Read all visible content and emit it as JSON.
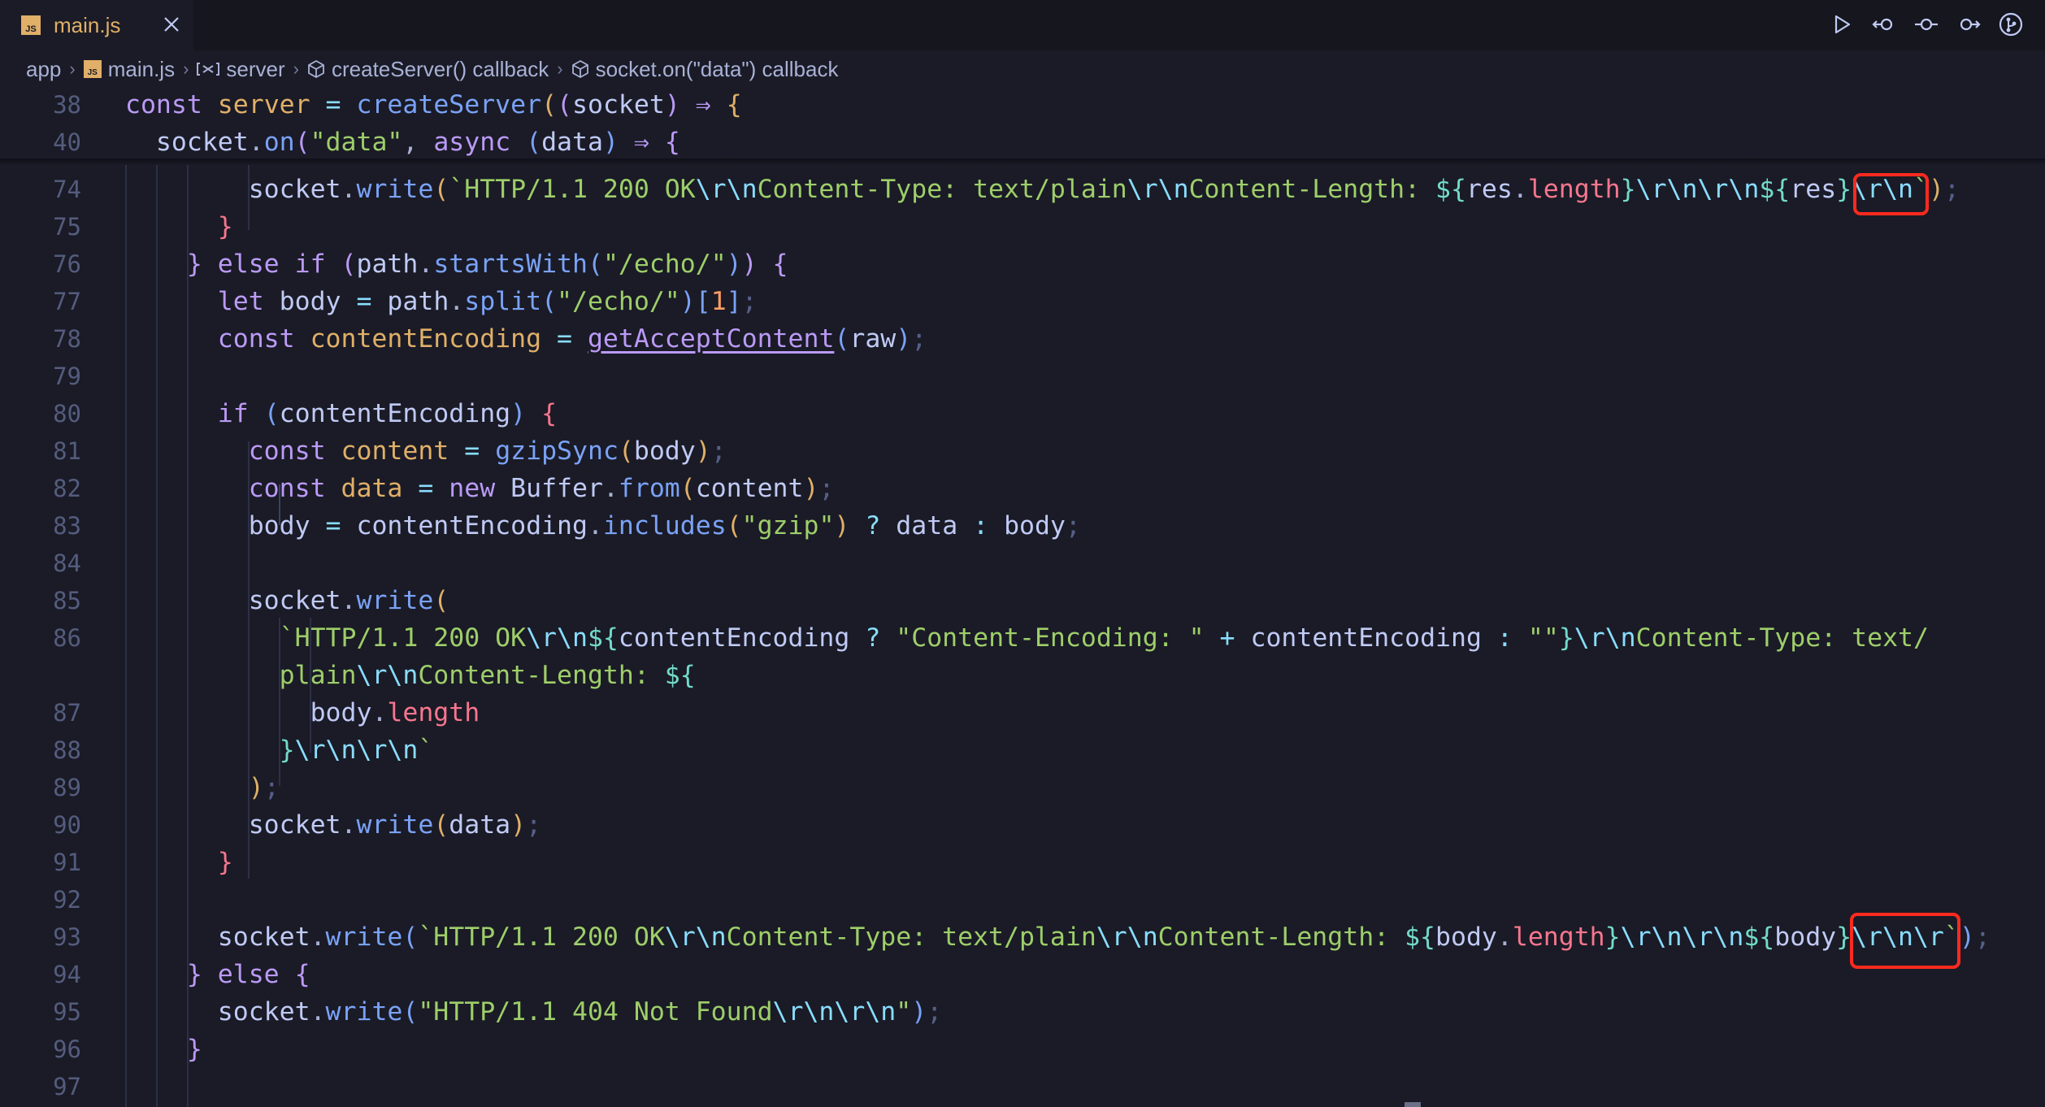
{
  "tab": {
    "label": "main.js",
    "badge": "JS"
  },
  "breadcrumb": {
    "items": [
      "app",
      "main.js",
      "server",
      "createServer() callback",
      "socket.on(\"data\") callback"
    ]
  },
  "editor": {
    "lines": [
      {
        "n": "38",
        "tokens": [
          [
            "k",
            "const "
          ],
          [
            "pl",
            "server"
          ],
          [
            "o",
            " = "
          ],
          [
            "f",
            "createServer"
          ],
          [
            "b1",
            "("
          ],
          [
            "b2",
            "("
          ],
          [
            "v",
            "socket"
          ],
          [
            "b2",
            ")"
          ],
          [
            "k",
            " ⇒ "
          ],
          [
            "b1",
            "{"
          ]
        ]
      },
      {
        "n": "40",
        "tokens": [
          [
            "v",
            "  socket"
          ],
          [
            "p",
            "."
          ],
          [
            "f",
            "on"
          ],
          [
            "b2",
            "("
          ],
          [
            "s",
            "\"data\""
          ],
          [
            "p",
            ", "
          ],
          [
            "k",
            "async "
          ],
          [
            "b3",
            "("
          ],
          [
            "v",
            "data"
          ],
          [
            "b3",
            ")"
          ],
          [
            "k",
            " ⇒ "
          ],
          [
            "b2",
            "{"
          ]
        ]
      },
      {
        "n": "74",
        "tokens": [
          [
            "v",
            "        socket"
          ],
          [
            "p",
            "."
          ],
          [
            "f",
            "write"
          ],
          [
            "b1",
            "("
          ],
          [
            "s",
            "`HTTP/1.1 200 OK"
          ],
          [
            "o",
            "\\r\\n"
          ],
          [
            "s",
            "Content-Type: text/plain"
          ],
          [
            "o",
            "\\r\\n"
          ],
          [
            "s",
            "Content-Length: "
          ],
          [
            "c2",
            "${"
          ],
          [
            "v",
            "res"
          ],
          [
            "p",
            "."
          ],
          [
            "pp",
            "length"
          ],
          [
            "c2",
            "}"
          ],
          [
            "o",
            "\\r\\n\\r\\n"
          ],
          [
            "c2",
            "${"
          ],
          [
            "v",
            "res"
          ],
          [
            "c2",
            "}"
          ],
          [
            "o",
            "\\r\\n"
          ],
          [
            "s",
            "`"
          ],
          [
            "b1",
            ")"
          ],
          [
            "dim",
            ";"
          ]
        ]
      },
      {
        "n": "75",
        "tokens": [
          [
            "pp",
            "      }"
          ]
        ]
      },
      {
        "n": "76",
        "tokens": [
          [
            "b2",
            "    }"
          ],
          [
            "k",
            " else if "
          ],
          [
            "b2",
            "("
          ],
          [
            "v",
            "path"
          ],
          [
            "p",
            "."
          ],
          [
            "f",
            "startsWith"
          ],
          [
            "b3",
            "("
          ],
          [
            "s",
            "\"/echo/\""
          ],
          [
            "b3",
            ")"
          ],
          [
            "b2",
            ")"
          ],
          [
            "b2",
            " {"
          ]
        ]
      },
      {
        "n": "77",
        "tokens": [
          [
            "k",
            "      let "
          ],
          [
            "v",
            "body"
          ],
          [
            "o",
            " = "
          ],
          [
            "v",
            "path"
          ],
          [
            "p",
            "."
          ],
          [
            "f",
            "split"
          ],
          [
            "b3",
            "("
          ],
          [
            "s",
            "\"/echo/\""
          ],
          [
            "b3",
            ")"
          ],
          [
            "b3",
            "["
          ],
          [
            "n",
            "1"
          ],
          [
            "b3",
            "]"
          ],
          [
            "dim",
            ";"
          ]
        ]
      },
      {
        "n": "78",
        "tokens": [
          [
            "k",
            "      const "
          ],
          [
            "pl",
            "contentEncoding"
          ],
          [
            "o",
            " = "
          ],
          [
            "u",
            "getAcceptContent"
          ],
          [
            "b3",
            "("
          ],
          [
            "v",
            "raw"
          ],
          [
            "b3",
            ")"
          ],
          [
            "dim",
            ";"
          ]
        ]
      },
      {
        "n": "79",
        "tokens": []
      },
      {
        "n": "80",
        "tokens": [
          [
            "k",
            "      if "
          ],
          [
            "b3",
            "("
          ],
          [
            "v",
            "contentEncoding"
          ],
          [
            "b3",
            ")"
          ],
          [
            "pp",
            " {"
          ]
        ]
      },
      {
        "n": "81",
        "tokens": [
          [
            "k",
            "        const "
          ],
          [
            "pl",
            "content"
          ],
          [
            "o",
            " = "
          ],
          [
            "f",
            "gzipSync"
          ],
          [
            "b1",
            "("
          ],
          [
            "v",
            "body"
          ],
          [
            "b1",
            ")"
          ],
          [
            "dim",
            ";"
          ]
        ]
      },
      {
        "n": "82",
        "tokens": [
          [
            "k",
            "        const "
          ],
          [
            "pl",
            "data"
          ],
          [
            "o",
            " = "
          ],
          [
            "k",
            "new "
          ],
          [
            "v",
            "Buffer"
          ],
          [
            "p",
            "."
          ],
          [
            "f",
            "from"
          ],
          [
            "b1",
            "("
          ],
          [
            "v",
            "content"
          ],
          [
            "b1",
            ")"
          ],
          [
            "dim",
            ";"
          ]
        ]
      },
      {
        "n": "83",
        "tokens": [
          [
            "v",
            "        body"
          ],
          [
            "o",
            " = "
          ],
          [
            "v",
            "contentEncoding"
          ],
          [
            "p",
            "."
          ],
          [
            "f",
            "includes"
          ],
          [
            "b1",
            "("
          ],
          [
            "s",
            "\"gzip\""
          ],
          [
            "b1",
            ")"
          ],
          [
            "o",
            " ? "
          ],
          [
            "v",
            "data"
          ],
          [
            "o",
            " : "
          ],
          [
            "v",
            "body"
          ],
          [
            "dim",
            ";"
          ]
        ]
      },
      {
        "n": "84",
        "tokens": []
      },
      {
        "n": "85",
        "tokens": [
          [
            "v",
            "        socket"
          ],
          [
            "p",
            "."
          ],
          [
            "f",
            "write"
          ],
          [
            "b1",
            "("
          ]
        ]
      },
      {
        "n": "86",
        "tokens": [
          [
            "s",
            "          `HTTP/1.1 200 OK"
          ],
          [
            "o",
            "\\r\\n"
          ],
          [
            "c2",
            "${"
          ],
          [
            "v",
            "contentEncoding"
          ],
          [
            "o",
            " ? "
          ],
          [
            "s",
            "\"Content-Encoding: \""
          ],
          [
            "o",
            " + "
          ],
          [
            "v",
            "contentEncoding"
          ],
          [
            "o",
            " : "
          ],
          [
            "s",
            "\"\""
          ],
          [
            "c2",
            "}"
          ],
          [
            "o",
            "\\r\\n"
          ],
          [
            "s",
            "Content-Type: text/"
          ]
        ]
      },
      {
        "n": "",
        "tokens": [
          [
            "s",
            "          plain"
          ],
          [
            "o",
            "\\r\\n"
          ],
          [
            "s",
            "Content-Length: "
          ],
          [
            "c2",
            "${"
          ]
        ]
      },
      {
        "n": "87",
        "tokens": [
          [
            "v",
            "            body"
          ],
          [
            "p",
            "."
          ],
          [
            "pp",
            "length"
          ]
        ]
      },
      {
        "n": "88",
        "tokens": [
          [
            "c2",
            "          }"
          ],
          [
            "o",
            "\\r\\n\\r\\n"
          ],
          [
            "s",
            "`"
          ]
        ]
      },
      {
        "n": "89",
        "tokens": [
          [
            "b1",
            "        )"
          ],
          [
            "dim",
            ";"
          ]
        ]
      },
      {
        "n": "90",
        "tokens": [
          [
            "v",
            "        socket"
          ],
          [
            "p",
            "."
          ],
          [
            "f",
            "write"
          ],
          [
            "b1",
            "("
          ],
          [
            "v",
            "data"
          ],
          [
            "b1",
            ")"
          ],
          [
            "dim",
            ";"
          ]
        ]
      },
      {
        "n": "91",
        "tokens": [
          [
            "pp",
            "      }"
          ]
        ]
      },
      {
        "n": "92",
        "tokens": []
      },
      {
        "n": "93",
        "tokens": [
          [
            "v",
            "      socket"
          ],
          [
            "p",
            "."
          ],
          [
            "f",
            "write"
          ],
          [
            "b3",
            "("
          ],
          [
            "s",
            "`HTTP/1.1 200 OK"
          ],
          [
            "o",
            "\\r\\n"
          ],
          [
            "s",
            "Content-Type: text/plain"
          ],
          [
            "o",
            "\\r\\n"
          ],
          [
            "s",
            "Content-Length: "
          ],
          [
            "c2",
            "${"
          ],
          [
            "v",
            "body"
          ],
          [
            "p",
            "."
          ],
          [
            "pp",
            "length"
          ],
          [
            "c2",
            "}"
          ],
          [
            "o",
            "\\r\\n\\r\\n"
          ],
          [
            "c2",
            "${"
          ],
          [
            "v",
            "body"
          ],
          [
            "c2",
            "}"
          ],
          [
            "o",
            "\\r\\n\\r"
          ],
          [
            "s",
            "`"
          ],
          [
            "b3",
            ")"
          ],
          [
            "dim",
            ";"
          ]
        ]
      },
      {
        "n": "94",
        "tokens": [
          [
            "b2",
            "    }"
          ],
          [
            "k",
            " else "
          ],
          [
            "b2",
            "{"
          ]
        ]
      },
      {
        "n": "95",
        "tokens": [
          [
            "v",
            "      socket"
          ],
          [
            "p",
            "."
          ],
          [
            "f",
            "write"
          ],
          [
            "b3",
            "("
          ],
          [
            "s",
            "\"HTTP/1.1 404 Not Found"
          ],
          [
            "o",
            "\\r\\n\\r\\n"
          ],
          [
            "s",
            "\""
          ],
          [
            "b3",
            ")"
          ],
          [
            "dim",
            ";"
          ]
        ]
      },
      {
        "n": "96",
        "tokens": [
          [
            "b2",
            "    }"
          ]
        ]
      },
      {
        "n": "97",
        "tokens": []
      }
    ]
  },
  "colors": {
    "highlight_box": "#ff2a1f",
    "background": "#1a1b26",
    "js_badge": "#e0af68"
  }
}
